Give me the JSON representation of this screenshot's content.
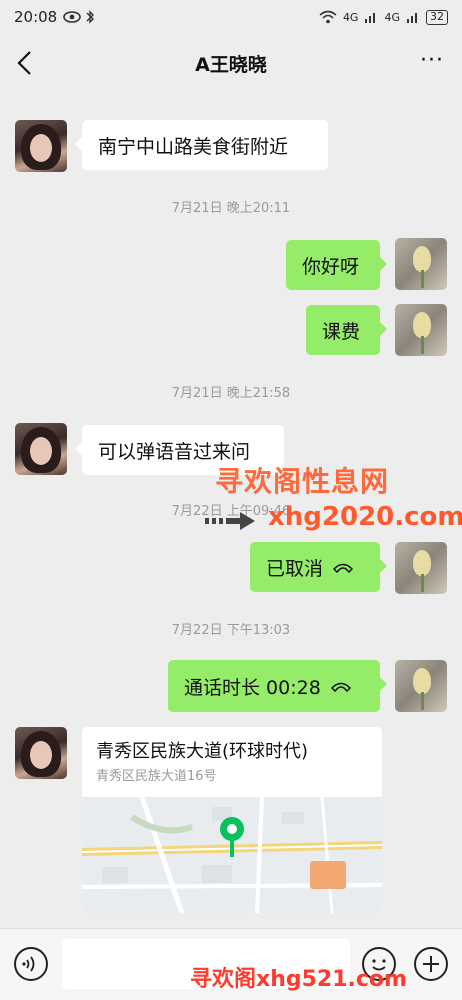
{
  "status_bar": {
    "time": "20:08",
    "signal1": "4G",
    "signal2": "4G",
    "battery": "32"
  },
  "header": {
    "title": "A王晓晓"
  },
  "messages": [
    {
      "side": "in",
      "text": "南宁中山路美食街附近"
    },
    {
      "type": "time",
      "text": "7月21日 晚上20:11"
    },
    {
      "side": "out",
      "text": "你好呀"
    },
    {
      "side": "out",
      "text": "课费"
    },
    {
      "type": "time",
      "text": "7月21日 晚上21:58"
    },
    {
      "side": "in",
      "text": "可以弹语音过来问"
    },
    {
      "type": "time",
      "text": "7月22日 上午09:46"
    },
    {
      "side": "out",
      "text": "已取消"
    },
    {
      "type": "time",
      "text": "7月22日 下午13:03"
    },
    {
      "side": "out",
      "text": "通话时长 00:28"
    }
  ],
  "location": {
    "title": "青秀区民族大道(环球时代)",
    "subtitle": "青秀区民族大道16号"
  },
  "watermarks": {
    "site_name": "寻欢阁性息网",
    "site_url": "xhg2020.com",
    "bottom": "寻欢阁xhg521.com"
  },
  "colors": {
    "accent_green": "#95ec69",
    "background": "#ededed",
    "watermark": "#ff5a2e"
  }
}
